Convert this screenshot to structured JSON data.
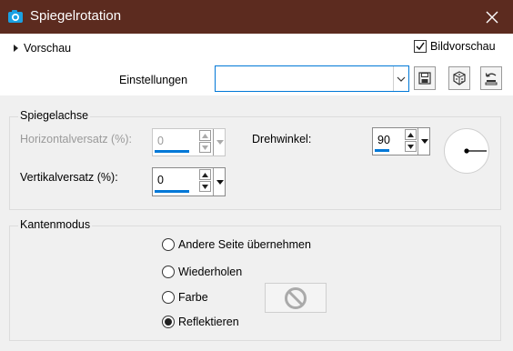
{
  "window": {
    "title": "Spiegelrotation",
    "app_icon": "camera-icon",
    "close_icon": "close-icon"
  },
  "top": {
    "preview_label": "Vorschau",
    "bildvorschau": {
      "label": "Bildvorschau",
      "checked": true
    },
    "settings_label": "Einstellungen",
    "settings_value": "",
    "toolbar_icons": [
      "save-icon",
      "randomize-dice-icon",
      "reset-icon"
    ]
  },
  "spiegelachse": {
    "legend": "Spiegelachse",
    "horizontal": {
      "label": "Horizontalversatz (%):",
      "value": "0",
      "enabled": false
    },
    "vertikal": {
      "label": "Vertikalversatz (%):",
      "value": "0"
    },
    "drehwinkel": {
      "label": "Drehwinkel:",
      "value": "90"
    }
  },
  "kantenmodus": {
    "legend": "Kantenmodus",
    "options": [
      {
        "label": "Andere Seite übernehmen",
        "selected": false
      },
      {
        "label": "Wiederholen",
        "selected": false
      },
      {
        "label": "Farbe",
        "selected": false
      },
      {
        "label": "Reflektieren",
        "selected": true
      }
    ],
    "color_swatch_icon": "no-color-icon"
  },
  "colors": {
    "titlebar": "#5c2b1f",
    "accent": "#0078d7",
    "panel": "#f0f0f0"
  }
}
